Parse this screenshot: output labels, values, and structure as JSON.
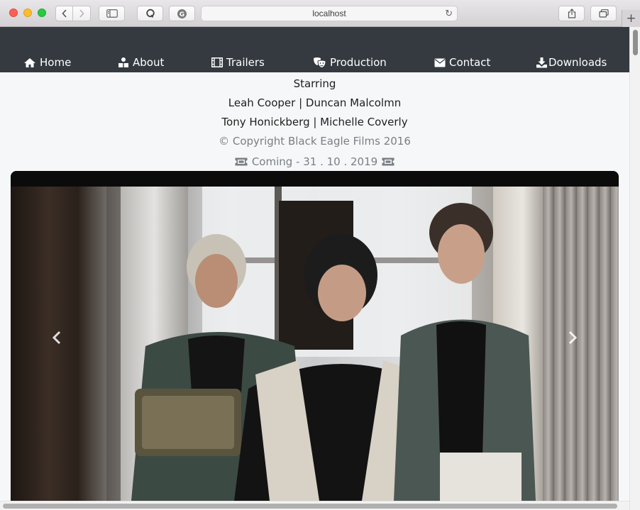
{
  "browser": {
    "address": "localhost"
  },
  "navbar": {
    "items": [
      {
        "label": "Home",
        "icon": "home-icon"
      },
      {
        "label": "About",
        "icon": "users-icon"
      },
      {
        "label": "Trailers",
        "icon": "film-icon"
      },
      {
        "label": "Production",
        "icon": "theater-masks-icon"
      },
      {
        "label": "Contact",
        "icon": "envelope-icon"
      },
      {
        "label": "Downloads",
        "icon": "download-icon"
      }
    ]
  },
  "content": {
    "starring": "Starring",
    "cast_line_1": "Leah Cooper | Duncan Malcolmn",
    "cast_line_2": "Tony Honickberg | Michelle Coverly",
    "copyright": "© Copyright Black Eagle Films 2016",
    "coming": "Coming - 31 . 10 . 2019"
  },
  "carousel": {
    "prev_icon": "chevron-left-icon",
    "next_icon": "chevron-right-icon"
  },
  "colors": {
    "navbar_bg": "#343a40",
    "page_bg": "#f6f7f8",
    "muted_text": "#7a7f85"
  }
}
